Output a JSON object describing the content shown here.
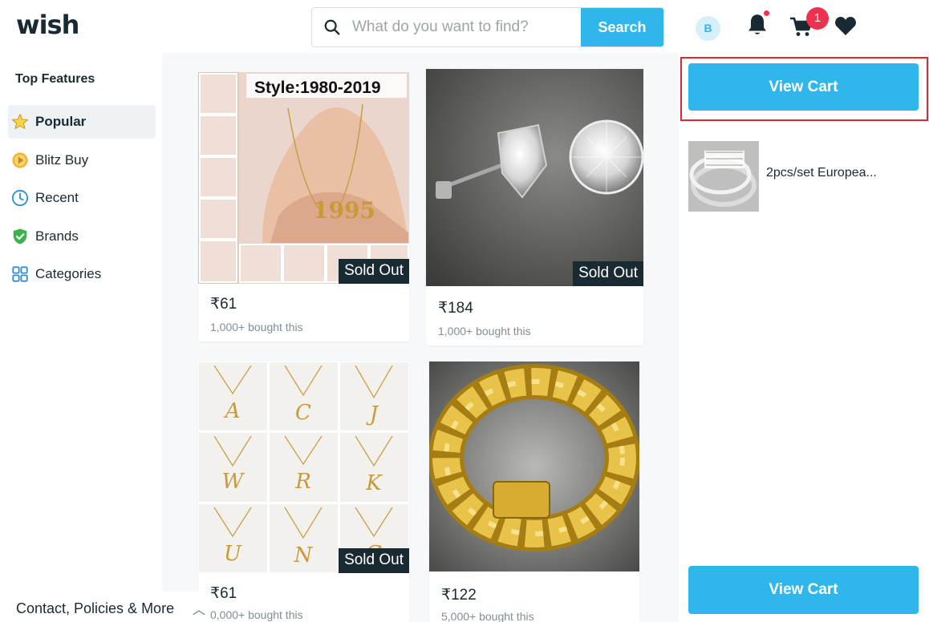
{
  "header": {
    "logo": "wish",
    "search_placeholder": "What do you want to find?",
    "search_button": "Search",
    "avatar_initial": "B",
    "cart_count": "1"
  },
  "sidebar": {
    "title": "Top Features",
    "items": [
      {
        "label": "Popular",
        "icon": "star-icon"
      },
      {
        "label": "Blitz Buy",
        "icon": "blitz-buy-icon"
      },
      {
        "label": "Recent",
        "icon": "clock-icon"
      },
      {
        "label": "Brands",
        "icon": "verified-shield-icon"
      },
      {
        "label": "Categories",
        "icon": "grid-icon"
      }
    ],
    "footer": "Contact, Policies & More"
  },
  "products": [
    {
      "price": "₹61",
      "bought": "1,000+ bought this",
      "badge": "Sold Out",
      "image_caption": "Style:1980-2019",
      "image_text": "1995"
    },
    {
      "price": "₹184",
      "bought": "1,000+ bought this",
      "badge": "Sold Out"
    },
    {
      "price": "₹61",
      "bought": "0,000+ bought this",
      "badge": "Sold Out"
    },
    {
      "price": "₹122",
      "bought": "5,000+ bought this"
    }
  ],
  "cart_panel": {
    "view_cart_top": "View Cart",
    "view_cart_bottom": "View Cart",
    "item_label": "2pcs/set Europea..."
  },
  "colors": {
    "accent": "#2fb7ec",
    "badge": "#f0304f",
    "highlight": "#e0262f",
    "text": "#192a32"
  }
}
